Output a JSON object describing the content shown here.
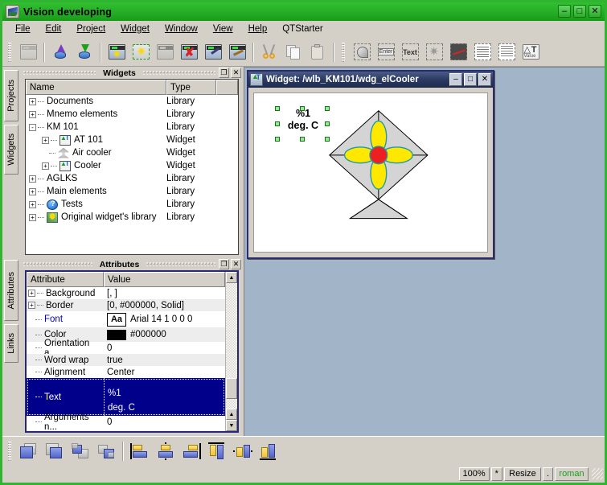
{
  "window": {
    "title": "Vision developing",
    "icon": "vision-app-icon",
    "buttons": {
      "minimize": "–",
      "maximize": "□",
      "close": "✕"
    }
  },
  "menubar": {
    "items": [
      {
        "label": "File",
        "accel": "F"
      },
      {
        "label": "Edit",
        "accel": "E"
      },
      {
        "label": "Project",
        "accel": "P"
      },
      {
        "label": "Widget",
        "accel": "W"
      },
      {
        "label": "Window",
        "accel": "W"
      },
      {
        "label": "View",
        "accel": "V"
      },
      {
        "label": "Help",
        "accel": "H"
      },
      {
        "label": "QTStarter",
        "accel": ""
      }
    ]
  },
  "toolbar": {
    "groups": [
      {
        "icons": [
          "project-export-icon"
        ]
      },
      {
        "icons": [
          "db-load-icon",
          "db-save-icon"
        ]
      },
      {
        "icons": [
          "new-widget-icon",
          "new-library-icon",
          "add-widget-icon",
          "delete-widget-icon",
          "edit-widget-icon",
          "properties-widget-icon"
        ]
      },
      {
        "icons": [
          "cut-icon",
          "copy-icon",
          "paste-icon"
        ]
      },
      {
        "icons": [
          "shape-element-icon",
          "form-element-icon",
          "text-element-icon",
          "media-element-icon",
          "diagram-element-icon",
          "protocol-element-icon",
          "document-element-icon",
          "value-element-icon"
        ]
      }
    ]
  },
  "sidetabs": {
    "items": [
      {
        "label": "Projects"
      },
      {
        "label": "Widgets"
      },
      {
        "label": "Attributes"
      },
      {
        "label": "Links"
      }
    ]
  },
  "widgets_panel": {
    "title": "Widgets",
    "restore_label": "❐",
    "close_label": "✕",
    "columns": [
      "Name",
      "Type"
    ],
    "rows": [
      {
        "indent": 0,
        "expander": "+",
        "icon": "",
        "name": "Documents",
        "type": "Library"
      },
      {
        "indent": 0,
        "expander": "+",
        "icon": "",
        "name": "Mnemo elements",
        "type": "Library"
      },
      {
        "indent": 0,
        "expander": "-",
        "icon": "",
        "name": "KM 101",
        "type": "Library"
      },
      {
        "indent": 1,
        "expander": "+",
        "icon": "value-text-icon",
        "name": "AT 101",
        "type": "Widget"
      },
      {
        "indent": 1,
        "expander": "",
        "icon": "cooler-icon",
        "name": "Air cooler",
        "type": "Widget"
      },
      {
        "indent": 1,
        "expander": "+",
        "icon": "value-text-icon",
        "name": "Cooler",
        "type": "Widget"
      },
      {
        "indent": 0,
        "expander": "+",
        "icon": "",
        "name": "AGLKS",
        "type": "Library"
      },
      {
        "indent": 0,
        "expander": "+",
        "icon": "",
        "name": "Main elements",
        "type": "Library"
      },
      {
        "indent": 0,
        "expander": "+",
        "icon": "help-icon",
        "name": "Tests",
        "type": "Library"
      },
      {
        "indent": 0,
        "expander": "+",
        "icon": "star-icon",
        "name": "Original widget's library",
        "type": "Library"
      }
    ]
  },
  "attributes_panel": {
    "title": "Attributes",
    "restore_label": "❐",
    "close_label": "✕",
    "columns": [
      "Attribute",
      "Value"
    ],
    "rows": [
      {
        "expander": "+",
        "name": "Background",
        "value": "[, ]",
        "kind": "text",
        "selected": false
      },
      {
        "expander": "+",
        "name": "Border",
        "value": "[0, #000000, Solid]",
        "kind": "text",
        "selected": false
      },
      {
        "expander": "",
        "name": "Font",
        "value": "Arial 14 1 0 0 0",
        "kind": "font",
        "chip": "Aa",
        "selected": false,
        "name_color": "#0000cc"
      },
      {
        "expander": "",
        "name": "Color",
        "value": "#000000",
        "kind": "color",
        "chip_color": "#000000",
        "selected": false
      },
      {
        "expander": "",
        "name": "Orientation a...",
        "value": "0",
        "kind": "text",
        "selected": false
      },
      {
        "expander": "",
        "name": "Word wrap",
        "value": "true",
        "kind": "text",
        "selected": false
      },
      {
        "expander": "",
        "name": "Alignment",
        "value": "Center",
        "kind": "text",
        "selected": false
      },
      {
        "expander": "",
        "name": "Text",
        "value": "%1\ndeg. C",
        "value_line1": "%1",
        "value_line2": "deg. C",
        "kind": "multiline",
        "selected": true
      },
      {
        "expander": "",
        "name": "Arguments n...",
        "value": "0",
        "kind": "text",
        "selected": false
      }
    ],
    "scroll": {
      "up": "▲",
      "down": "▼"
    }
  },
  "mdi": {
    "window": {
      "title": "Widget: /wlb_KM101/wdg_elCooler",
      "icon": "value-text-icon",
      "minimize": "–",
      "maximize": "□",
      "close": "✕"
    },
    "canvas": {
      "selected_text_line1": "%1",
      "selected_text_line2": "deg. C",
      "shape": "air-cooler-fan-diagram"
    }
  },
  "bottom_toolbar": {
    "icons": [
      "bring-to-front-icon",
      "send-to-back-icon",
      "raise-one-icon",
      "lower-one-icon",
      "align-left-icon",
      "align-center-horizontal-icon",
      "align-right-icon",
      "align-top-icon",
      "align-center-vertical-icon",
      "align-bottom-icon"
    ]
  },
  "statusbar": {
    "zoom": "100%",
    "modified": "*",
    "mode": "Resize",
    "separator": ".",
    "user": "roman"
  }
}
